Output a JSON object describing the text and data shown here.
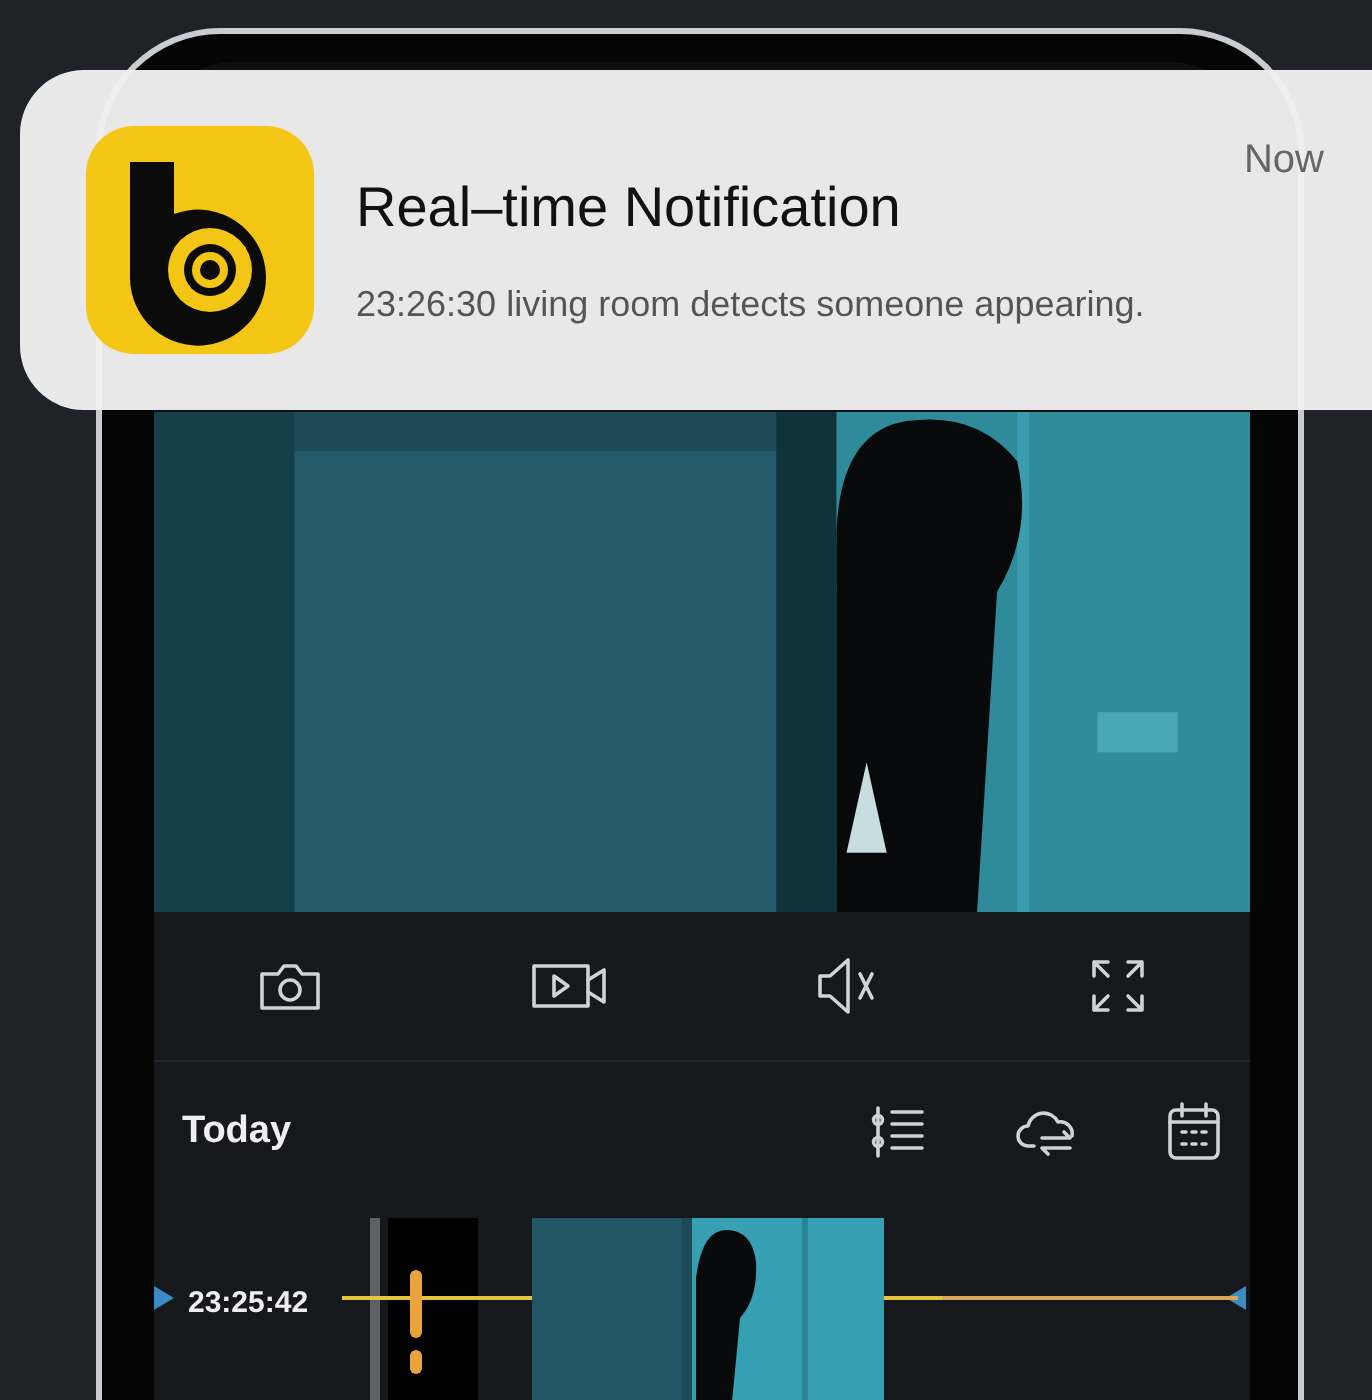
{
  "notification": {
    "title": "Real–time Notification",
    "message": "23:26:30 living room detects someone appearing.",
    "time": "Now"
  },
  "controls": [
    {
      "kind": "snapshot"
    },
    {
      "kind": "record"
    },
    {
      "kind": "mute"
    },
    {
      "kind": "fullscreen"
    }
  ],
  "timeline_header": {
    "label": "Today",
    "tools": [
      {
        "kind": "filter"
      },
      {
        "kind": "cloud"
      },
      {
        "kind": "calendar"
      }
    ]
  },
  "timeline": {
    "time": "23:25:42"
  }
}
